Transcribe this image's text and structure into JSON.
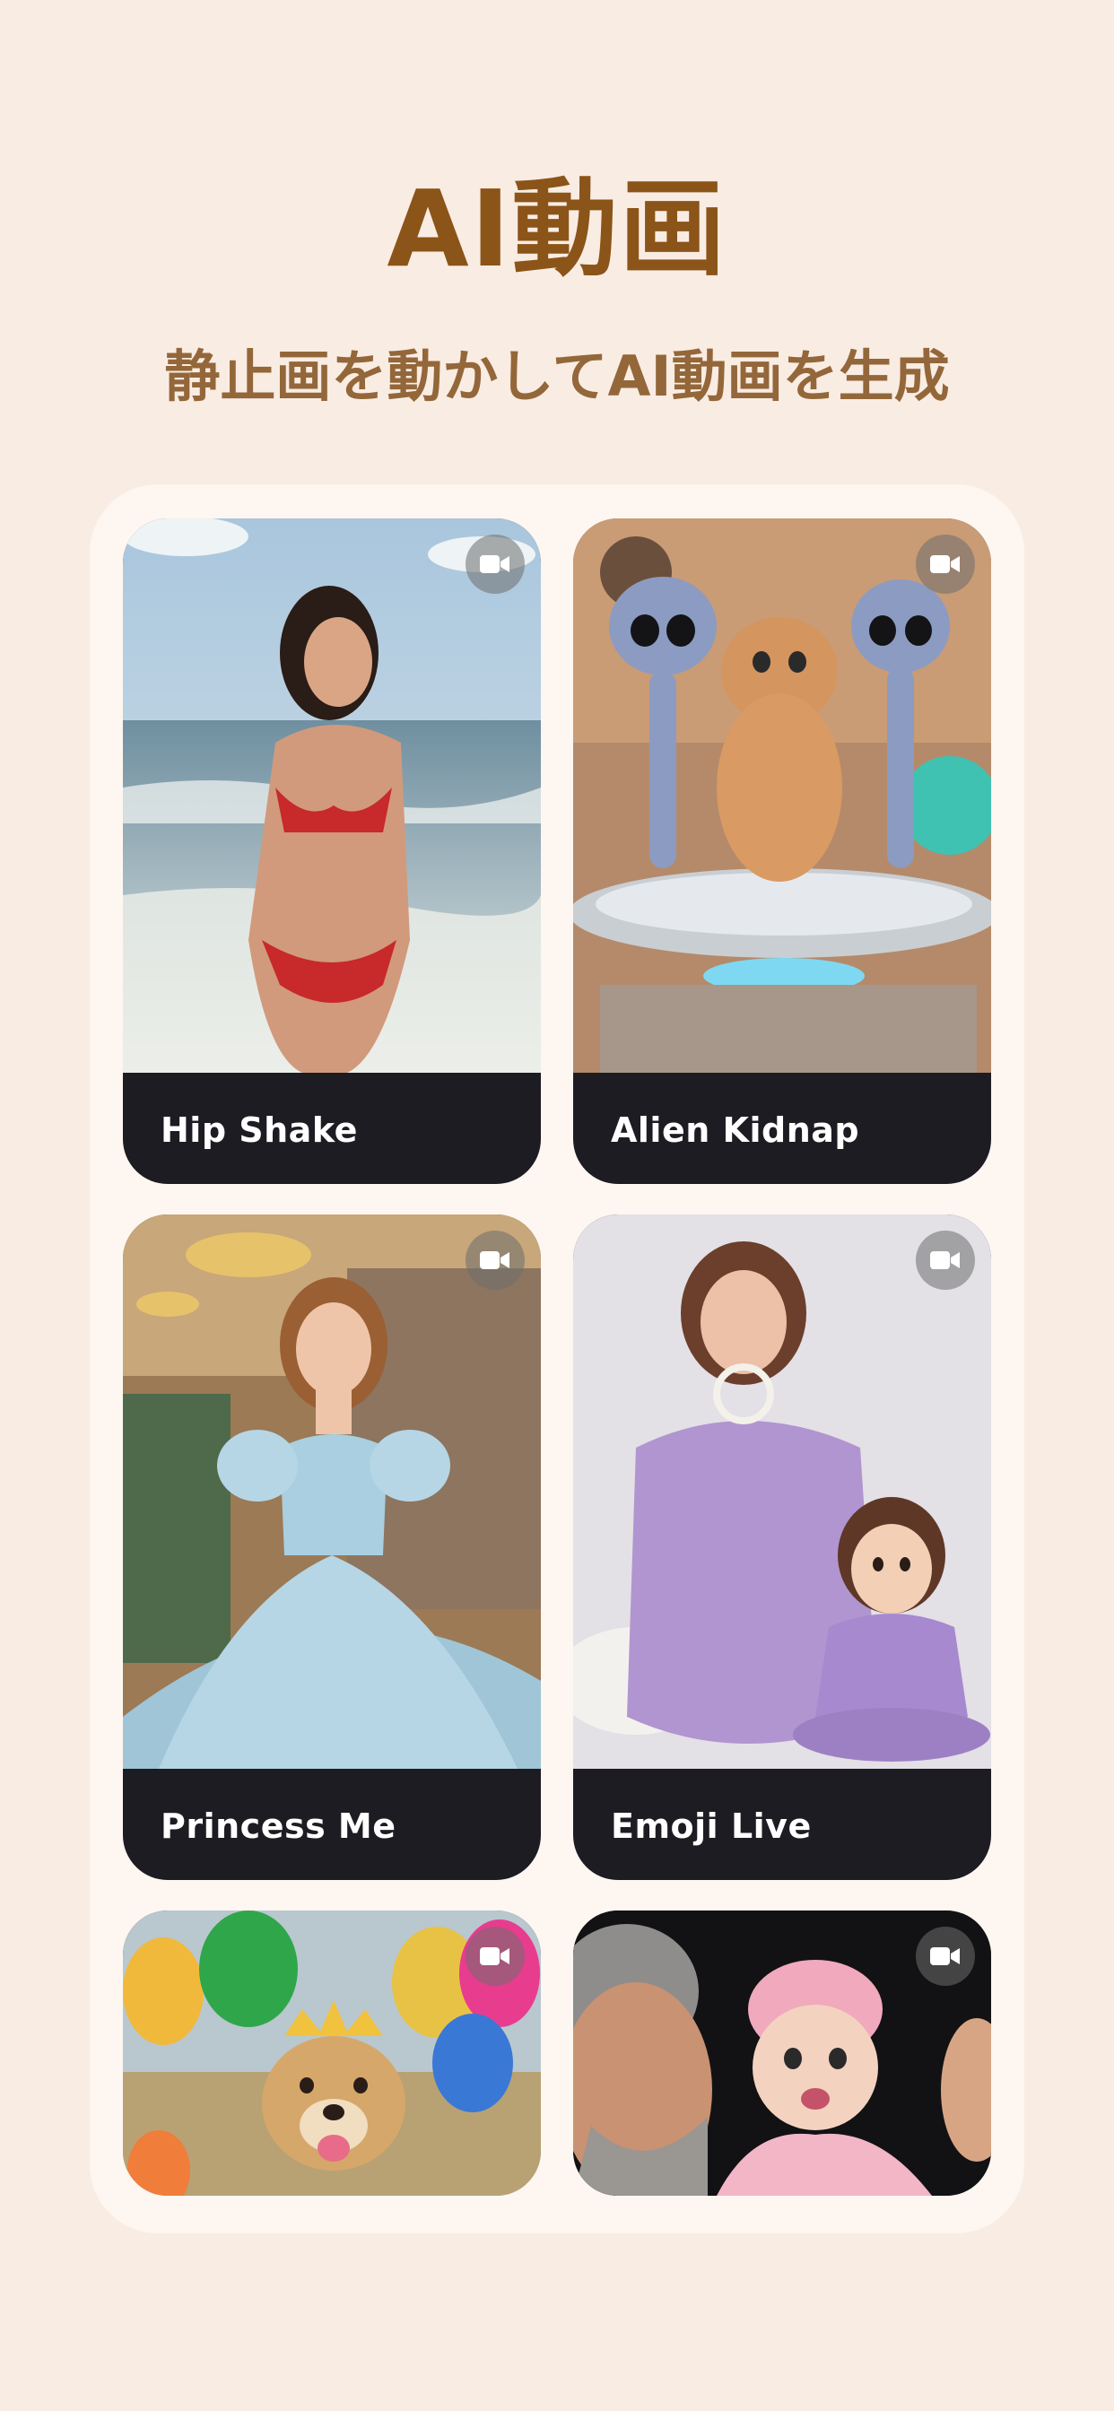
{
  "header": {
    "title": "AI動画",
    "subtitle": "静止画を動かしてAI動画を生成"
  },
  "cards": [
    {
      "label": "Hip Shake",
      "icon": "video-camera-icon"
    },
    {
      "label": "Alien Kidnap",
      "icon": "video-camera-icon"
    },
    {
      "label": "Princess Me",
      "icon": "video-camera-icon"
    },
    {
      "label": "Emoji Live",
      "icon": "video-camera-icon"
    },
    {
      "label": "",
      "icon": "video-camera-icon"
    },
    {
      "label": "",
      "icon": "video-camera-icon"
    }
  ],
  "colors": {
    "background": "#f9ece3",
    "title": "#8b5418",
    "subtitle": "#93673a",
    "card_label_bg": "#1c1c22"
  }
}
